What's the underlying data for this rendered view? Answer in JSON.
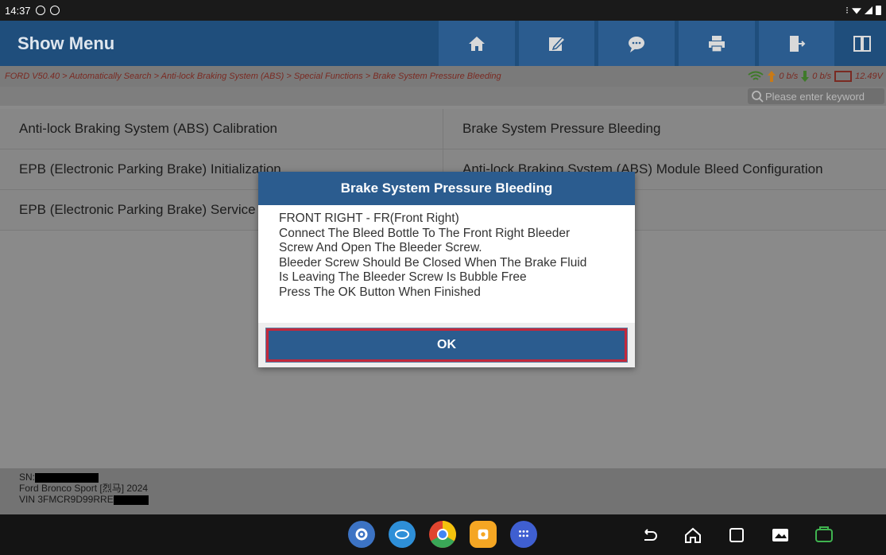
{
  "status_bar": {
    "time": "14:37"
  },
  "header": {
    "title": "Show Menu"
  },
  "toolbar": [
    "home-icon",
    "edit-icon",
    "chat-icon",
    "print-icon",
    "exit-icon",
    "split-view-icon"
  ],
  "breadcrumb": {
    "path": "FORD V50.40 > Automatically Search > Anti-lock Braking System (ABS) > Special Functions > Brake System Pressure Bleeding",
    "upload_rate": "0 b/s",
    "download_rate": "0 b/s",
    "voltage": "12.49V"
  },
  "search": {
    "placeholder": "Please enter keyword"
  },
  "menu": {
    "items": [
      "Anti-lock Braking System (ABS) Calibration",
      "Brake System Pressure Bleeding",
      "EPB (Electronic Parking Brake) Initialization",
      "Anti-lock Braking System (ABS) Module Bleed Configuration",
      "EPB (Electronic Parking Brake) Service"
    ]
  },
  "footer": {
    "sn_label": "SN:",
    "vehicle": "Ford Bronco Sport [烈马] 2024",
    "vin_prefix": "VIN 3FMCR9D99RRE"
  },
  "dialog": {
    "title": "Brake System Pressure Bleeding",
    "lines": [
      "FRONT RIGHT - FR(Front Right)",
      "Connect The Bleed Bottle To The Front Right Bleeder",
      "Screw And Open The Bleeder Screw.",
      "Bleeder Screw Should Be Closed When The Brake Fluid",
      "Is Leaving The Bleeder Screw Is Bubble Free",
      "Press The OK Button When Finished"
    ],
    "ok_label": "OK"
  },
  "colors": {
    "accent": "#2b5c8f",
    "highlight": "#c3283b"
  }
}
